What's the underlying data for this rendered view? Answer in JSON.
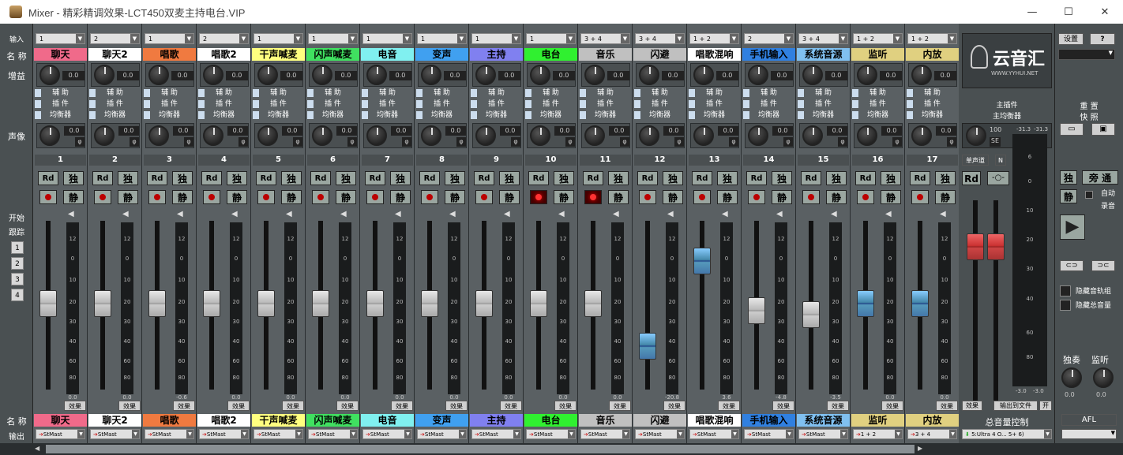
{
  "window": {
    "title": "Mixer - 精彩精调效果-LCT450双麦主持电台.VIP"
  },
  "labels": {
    "input": "输入",
    "name": "名 称",
    "gain": "增益",
    "pan": "声像",
    "start": "开始",
    "track": "跟踪",
    "name_bottom": "名 称",
    "output": "输出",
    "nums": [
      "1",
      "2",
      "3",
      "4"
    ]
  },
  "strip_rows": {
    "aux": "辅 助",
    "plugin": "插 件",
    "eq": "均衡器",
    "rd": "Rd",
    "solo": "独",
    "mute": "静",
    "fx": "效果"
  },
  "channels": [
    {
      "num": "1",
      "input": "1",
      "name": "聊天",
      "color": "#f06a8a",
      "gain": "0.0",
      "pan": "0.0",
      "meter": "0.0",
      "out": "StMast",
      "fader": 0.5,
      "cap": "white",
      "rec": false
    },
    {
      "num": "2",
      "input": "2",
      "name": "聊天2",
      "color": "#ffffff",
      "gain": "0.0",
      "pan": "0.0",
      "meter": "0.0",
      "out": "StMast",
      "fader": 0.5,
      "cap": "white",
      "rec": false
    },
    {
      "num": "3",
      "input": "1",
      "name": "唱歌",
      "color": "#f07a40",
      "gain": "0.0",
      "pan": "0.0",
      "meter": "-0.6",
      "out": "StMast",
      "fader": 0.5,
      "cap": "white",
      "rec": false
    },
    {
      "num": "4",
      "input": "2",
      "name": "唱歌2",
      "color": "#ffffff",
      "gain": "0.0",
      "pan": "0.0",
      "meter": "0.0",
      "out": "StMast",
      "fader": 0.5,
      "cap": "white",
      "rec": false
    },
    {
      "num": "5",
      "input": "1",
      "name": "干声喊麦",
      "color": "#ffff80",
      "gain": "0.0",
      "pan": "0.0",
      "meter": "0.0",
      "out": "StMast",
      "fader": 0.5,
      "cap": "white",
      "rec": false
    },
    {
      "num": "6",
      "input": "1",
      "name": "闪声喊麦",
      "color": "#40e060",
      "gain": "0.0",
      "pan": "0.0",
      "meter": "0.0",
      "out": "StMast",
      "fader": 0.5,
      "cap": "white",
      "rec": false
    },
    {
      "num": "7",
      "input": "1",
      "name": "电音",
      "color": "#80f0f0",
      "gain": "0.0",
      "pan": "0.0",
      "meter": "0.0",
      "out": "StMast",
      "fader": 0.5,
      "cap": "white",
      "rec": false
    },
    {
      "num": "8",
      "input": "1",
      "name": "变声",
      "color": "#40a0f0",
      "gain": "0.0",
      "pan": "0.0",
      "meter": "0.0",
      "out": "StMast",
      "fader": 0.5,
      "cap": "white",
      "rec": false
    },
    {
      "num": "9",
      "input": "1",
      "name": "主持",
      "color": "#8080f0",
      "gain": "0.0",
      "pan": "0.0",
      "meter": "0.0",
      "out": "StMast",
      "fader": 0.5,
      "cap": "white",
      "rec": false
    },
    {
      "num": "10",
      "input": "1",
      "name": "电台",
      "color": "#30f030",
      "gain": "0.0",
      "pan": "0.0",
      "meter": "0.0",
      "out": "StMast",
      "fader": 0.5,
      "cap": "white",
      "rec": true
    },
    {
      "num": "11",
      "input": "3 + 4",
      "name": "音乐",
      "color": "#c0c0c0",
      "gain": "0.0",
      "pan": "0.0",
      "meter": "0.0",
      "out": "StMast",
      "fader": 0.5,
      "cap": "white",
      "rec": true
    },
    {
      "num": "12",
      "input": "3 + 4",
      "name": "闪避",
      "color": "#c0c0c0",
      "gain": "0.0",
      "pan": "0.0",
      "meter": "-20.8",
      "out": "StMast",
      "fader": 0.2,
      "cap": "blue",
      "rec": false
    },
    {
      "num": "13",
      "input": "1 + 2",
      "name": "唱歌混响",
      "color": "#ffffff",
      "gain": "0.0",
      "pan": "0.0",
      "meter": "3.6",
      "out": "StMast",
      "fader": 0.8,
      "cap": "blue",
      "rec": false
    },
    {
      "num": "14",
      "input": "2",
      "name": "手机输入",
      "color": "#3080e0",
      "gain": "0.0",
      "pan": "0.0",
      "meter": "-4.8",
      "out": "StMast",
      "fader": 0.45,
      "cap": "white",
      "rec": false
    },
    {
      "num": "15",
      "input": "3 + 4",
      "name": "系统音源",
      "color": "#80c0f0",
      "gain": "0.0",
      "pan": "0.0",
      "meter": "-3.5",
      "out": "StMast",
      "fader": 0.42,
      "cap": "white",
      "rec": false
    },
    {
      "num": "16",
      "input": "1 + 2",
      "name": "监听",
      "color": "#e0d080",
      "gain": "0.0",
      "pan": "0.0",
      "meter": "0.0",
      "out": "1 + 2",
      "fader": 0.5,
      "cap": "blue",
      "rec": false
    },
    {
      "num": "17",
      "input": "1 + 2",
      "name": "内放",
      "color": "#e0d080",
      "gain": "0.0",
      "pan": "0.0",
      "meter": "0.0",
      "out": "3 + 4",
      "fader": 0.5,
      "cap": "blue",
      "rec": false
    }
  ],
  "meter_ticks": [
    "12",
    "0",
    "10",
    "20",
    "30",
    "40",
    "60",
    "80"
  ],
  "master": {
    "logo_text": "云音汇",
    "logo_url": "WWW.YYHUI.NET",
    "main_plugin": "主插件",
    "main_eq": "主均衡器",
    "pan_val": "100",
    "pan_mode": "SE",
    "mono": "单声道",
    "n": "N",
    "rd": "Rd",
    "peak_l": "-31.3",
    "peak_r": "-31.3",
    "bottom_l": "-3.0",
    "bottom_r": "-3.0",
    "export": "输出到文件",
    "open": "开",
    "label": "总音量控制",
    "out": "5:Ultra 4 O... 5+ 6)",
    "ticks": [
      "6",
      "0",
      "10",
      "20",
      "30",
      "40",
      "60",
      "80"
    ]
  },
  "right": {
    "settings": "设置",
    "help": "?",
    "reset": "重 置",
    "snapshot": "快 照",
    "solo": "独",
    "bypass": "旁 通",
    "mute": "静",
    "auto_rec": "自动",
    "rec": "录音",
    "hide_tracks": "隐藏音轨组",
    "hide_master": "隐藏总音量",
    "solo_label": "独奏",
    "monitor_label": "监听",
    "knob_l": "0.0",
    "knob_r": "0.0",
    "afl": "AFL"
  }
}
